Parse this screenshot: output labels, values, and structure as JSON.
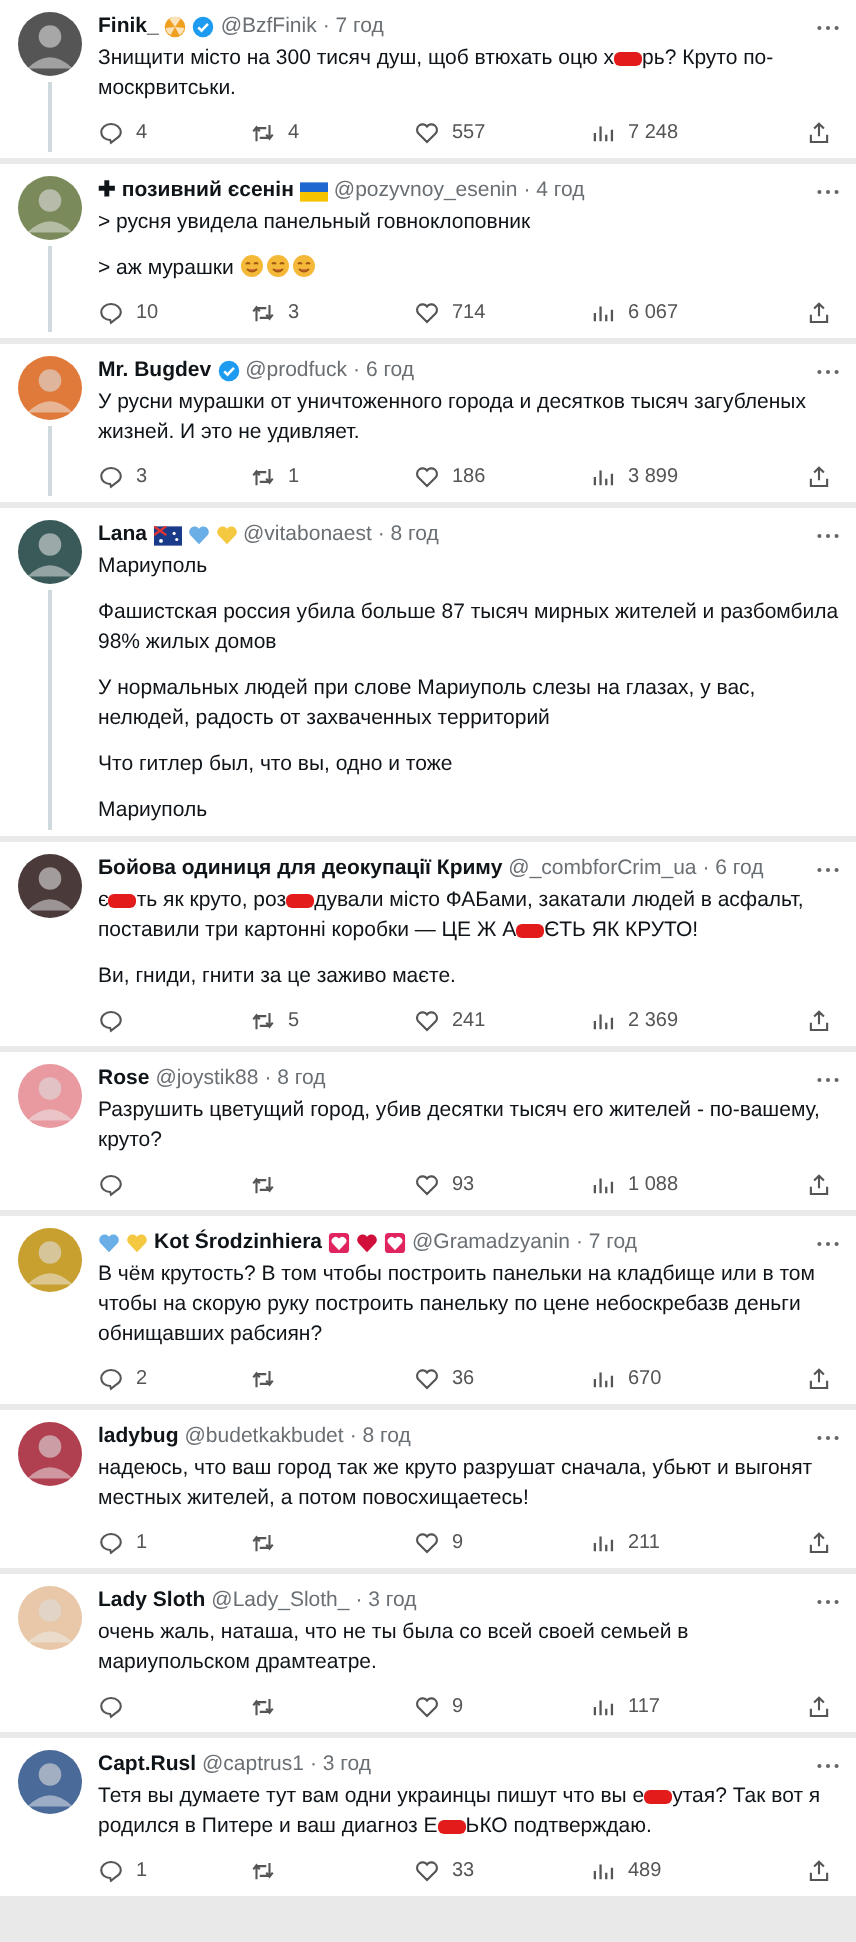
{
  "tweets": [
    {
      "name": "Finik_",
      "badges": [
        {
          "kind": "radiation",
          "color": "#f0a020"
        },
        {
          "kind": "verified",
          "color": "#1d9bf0"
        }
      ],
      "handle": "@BzfFinik",
      "time": "· 7 год",
      "thread": true,
      "body": [
        [
          {
            "t": "Знищити місто на 300 тисяч душ, щоб втюхать оцю х"
          },
          {
            "kind": "redaction"
          },
          {
            "t": "рь? Круто по-москрвитськи."
          }
        ]
      ],
      "stats": {
        "replies": "4",
        "reposts": "4",
        "likes": "557",
        "views": "7 248"
      }
    },
    {
      "name": "✚ позивний єсенін",
      "badges": [
        {
          "kind": "flag-ua",
          "color": "#f5c400"
        }
      ],
      "handle": "@pozyvnoy_esenin",
      "time": "· 4 год",
      "thread": true,
      "body": [
        [
          {
            "t": "> русня увидела панельный говноклоповник"
          }
        ],
        [
          {
            "t": "> аж мурашки "
          },
          {
            "kind": "emoji"
          },
          {
            "kind": "emoji"
          },
          {
            "kind": "emoji"
          }
        ]
      ],
      "stats": {
        "replies": "10",
        "reposts": "3",
        "likes": "714",
        "views": "6 067"
      }
    },
    {
      "name": "Mr. Bugdev",
      "badges": [
        {
          "kind": "verified",
          "color": "#1d9bf0"
        }
      ],
      "handle": "@prodfuck",
      "time": "· 6 год",
      "thread": true,
      "body": [
        [
          {
            "t": "У русни мурашки от уничтоженного города и десятков тысяч загубленых жизней. И это не удивляет."
          }
        ]
      ],
      "stats": {
        "replies": "3",
        "reposts": "1",
        "likes": "186",
        "views": "3 899"
      }
    },
    {
      "name": "Lana",
      "badges": [
        {
          "kind": "flag-au",
          "color": "#1a3a8a"
        },
        {
          "kind": "heart",
          "color": "#6aaee8"
        },
        {
          "kind": "heart",
          "color": "#f5c842"
        }
      ],
      "handle": "@vitabonaest",
      "time": "· 8 год",
      "thread": true,
      "body": [
        [
          {
            "t": "Мариуполь"
          }
        ],
        [
          {
            "t": "Фашистская россия убила больше 87 тысяч мирных жителей и разбомбила 98% жилых домов"
          }
        ],
        [
          {
            "t": "У нормальных людей при слове Мариуполь слезы на глазах, у вас, нелюдей, радость от захваченных территорий"
          }
        ],
        [
          {
            "t": "Что гитлер был, что вы, одно и тоже"
          }
        ],
        [
          {
            "t": "Мариуполь"
          }
        ]
      ]
    },
    {
      "name": "Бойова одиниця для деокупації Криму",
      "handle": "@_combforCrim_ua",
      "time": "· 6 год",
      "thread": false,
      "body": [
        [
          {
            "t": "є"
          },
          {
            "kind": "redaction"
          },
          {
            "t": "ть як круто, роз"
          },
          {
            "kind": "redaction"
          },
          {
            "t": "дували місто ФАБами, закатали людей в асфальт, поставили три картонні коробки — ЦЕ Ж А"
          },
          {
            "kind": "redaction"
          },
          {
            "t": "ЄТЬ ЯК КРУТО!"
          }
        ],
        [
          {
            "t": "Ви, гниди, гнити за це заживо маєте."
          }
        ]
      ],
      "stats": {
        "reposts": "5",
        "likes": "241",
        "views": "2 369"
      }
    },
    {
      "name": "Rose",
      "handle": "@joystik88",
      "time": "· 8 год",
      "thread": false,
      "body": [
        [
          {
            "t": "Разрушить цветущий город, убив десятки тысяч его жителей - по-вашему, круто?"
          }
        ]
      ],
      "stats": {
        "likes": "93",
        "views": "1 088"
      }
    },
    {
      "name": "Kot Środzinhiera",
      "badges_before": [
        {
          "kind": "heart",
          "color": "#6aaee8"
        },
        {
          "kind": "heart",
          "color": "#f5c842"
        }
      ],
      "badges": [
        {
          "kind": "heart-box",
          "color": "#e0245e"
        },
        {
          "kind": "heart",
          "color": "#d0103a"
        },
        {
          "kind": "heart-box",
          "color": "#e0245e"
        }
      ],
      "handle": "@Gramadzyanin",
      "time": "· 7 год",
      "thread": false,
      "body": [
        [
          {
            "t": "В чём крутость? В том чтобы построить панельки на кладбище или в том чтобы на скорую руку построить панельку по цене небоскребазв деньги обнищавших рабсиян?"
          }
        ]
      ],
      "stats": {
        "replies": "2",
        "likes": "36",
        "views": "670"
      }
    },
    {
      "name": "ladybug",
      "handle": "@budetkakbudet",
      "time": "· 8 год",
      "thread": false,
      "body": [
        [
          {
            "t": "надеюсь, что ваш город так же круто разрушат сначала, убьют и выгонят местных жителей, а потом повосхищаетесь!"
          }
        ]
      ],
      "stats": {
        "replies": "1",
        "likes": "9",
        "views": "211"
      }
    },
    {
      "name": "Lady Sloth",
      "handle": "@Lady_Sloth_",
      "time": "· 3 год",
      "thread": false,
      "body": [
        [
          {
            "t": "очень жаль, наташа, что не ты была со всей своей семьей в мариупольском драмтеатре."
          }
        ]
      ],
      "stats": {
        "likes": "9",
        "views": "117"
      }
    },
    {
      "name": "Capt.Rusl",
      "handle": "@captrus1",
      "time": "· 3 год",
      "thread": false,
      "body": [
        [
          {
            "t": "Тетя вы думаете тут вам одни украинцы пишут что вы е"
          },
          {
            "kind": "redaction"
          },
          {
            "t": "утая? Так вот я родился в Питере и ваш диагноз Е"
          },
          {
            "kind": "redaction"
          },
          {
            "t": "ЬКО подтверждаю."
          }
        ]
      ],
      "stats": {
        "replies": "1",
        "likes": "33",
        "views": "489"
      }
    }
  ]
}
